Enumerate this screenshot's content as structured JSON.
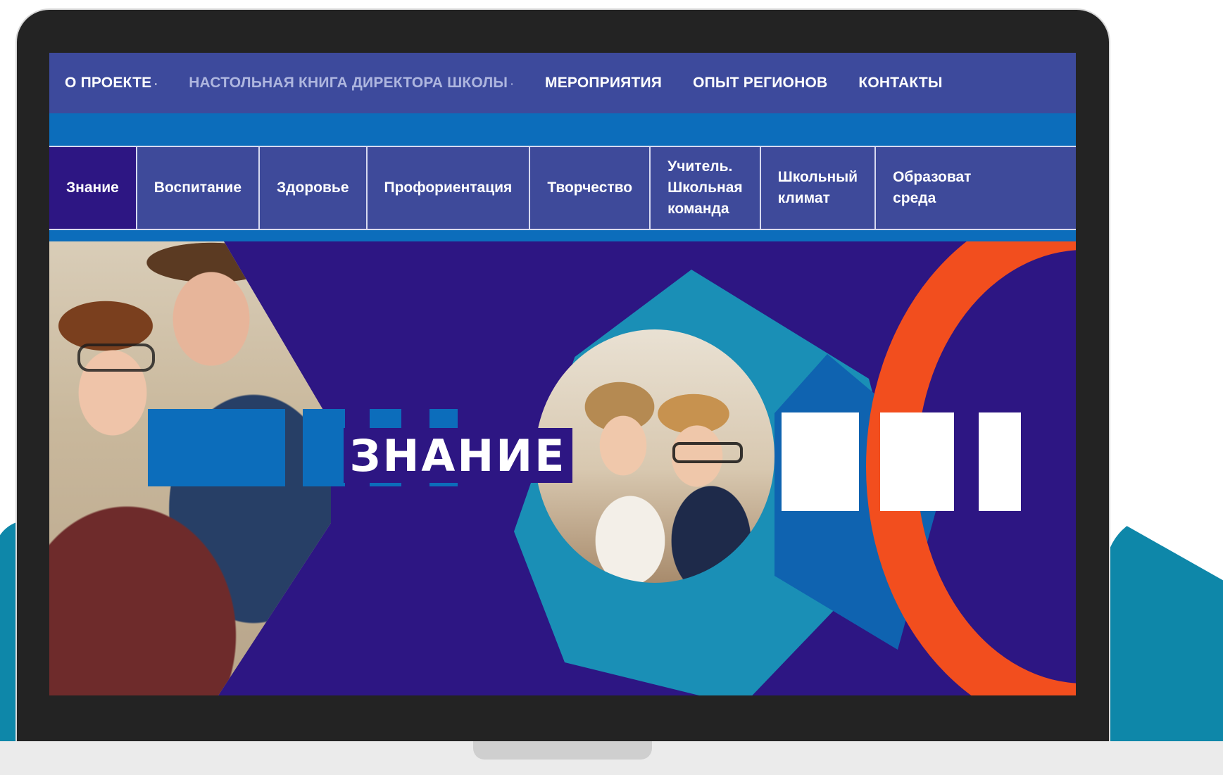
{
  "colors": {
    "nav_bg": "#3d4a9c",
    "brand_dark": "#2d1683",
    "brand_blue": "#0c6dbb",
    "teal": "#1a8fb6",
    "accent_orange": "#f24e1e",
    "active_nav_text": "#aeb6df"
  },
  "top_nav": {
    "items": [
      {
        "label": "О ПРОЕКТЕ",
        "has_dropdown": true
      },
      {
        "label": "НАСТОЛЬНАЯ КНИГА ДИРЕКТОРА ШКОЛЫ",
        "has_dropdown": true,
        "active": true
      },
      {
        "label": "МЕРОПРИЯТИЯ",
        "has_dropdown": false
      },
      {
        "label": "ОПЫТ РЕГИОНОВ",
        "has_dropdown": false
      },
      {
        "label": "КОНТАКТЫ",
        "has_dropdown": false
      }
    ],
    "dropdown_glyph": "·"
  },
  "tabs": [
    {
      "label": "Знание",
      "active": true
    },
    {
      "label": "Воспитание"
    },
    {
      "label": "Здоровье"
    },
    {
      "label": "Профориентация"
    },
    {
      "label": "Творчество"
    },
    {
      "label": "Учитель.\nШкольная\nкоманда"
    },
    {
      "label": "Школьный\nклимат"
    },
    {
      "label": "Образоват\nсреда"
    }
  ],
  "hero": {
    "title": "ЗНАНИЕ"
  }
}
